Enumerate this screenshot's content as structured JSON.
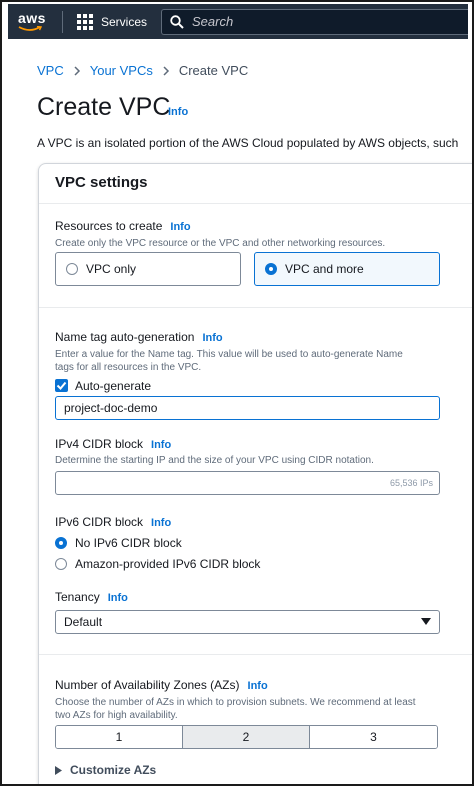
{
  "nav": {
    "logo": "aws",
    "services_label": "Services",
    "search_placeholder": "Search"
  },
  "breadcrumb": {
    "items": [
      "VPC",
      "Your VPCs",
      "Create VPC"
    ]
  },
  "page": {
    "title": "Create VPC",
    "info": "Info",
    "description": "A VPC is an isolated portion of the AWS Cloud populated by AWS objects, such"
  },
  "settings": {
    "header": "VPC settings",
    "resources": {
      "label": "Resources to create",
      "info": "Info",
      "hint": "Create only the VPC resource or the VPC and other networking resources.",
      "options": [
        "VPC only",
        "VPC and more"
      ],
      "selected": "VPC and more"
    },
    "name_tag": {
      "label": "Name tag auto-generation",
      "info": "Info",
      "hint_line1": "Enter a value for the Name tag. This value will be used to auto-generate Name",
      "hint_line2": "tags for all resources in the VPC.",
      "checkbox_label": "Auto-generate",
      "checked": true,
      "value": "project-doc-demo"
    },
    "ipv4": {
      "label": "IPv4 CIDR block",
      "info": "Info",
      "hint": "Determine the starting IP and the size of your VPC using CIDR notation.",
      "value": "",
      "suffix": "65,536 IPs"
    },
    "ipv6": {
      "label": "IPv6 CIDR block",
      "info": "Info",
      "options": [
        "No IPv6 CIDR block",
        "Amazon-provided IPv6 CIDR block"
      ],
      "selected": "No IPv6 CIDR block"
    },
    "tenancy": {
      "label": "Tenancy",
      "info": "Info",
      "value": "Default"
    },
    "azs": {
      "label": "Number of Availability Zones (AZs)",
      "info": "Info",
      "hint_line1": "Choose the number of AZs in which to provision subnets. We recommend at least",
      "hint_line2": "two AZs for high availability.",
      "options": [
        "1",
        "2",
        "3"
      ],
      "selected": "2",
      "customize": "Customize AZs"
    }
  },
  "colors": {
    "nav_bg": "#232f3e",
    "link": "#0972d3",
    "selected_bg": "#f2f8fd",
    "segment_active_bg": "#e9ebed"
  }
}
